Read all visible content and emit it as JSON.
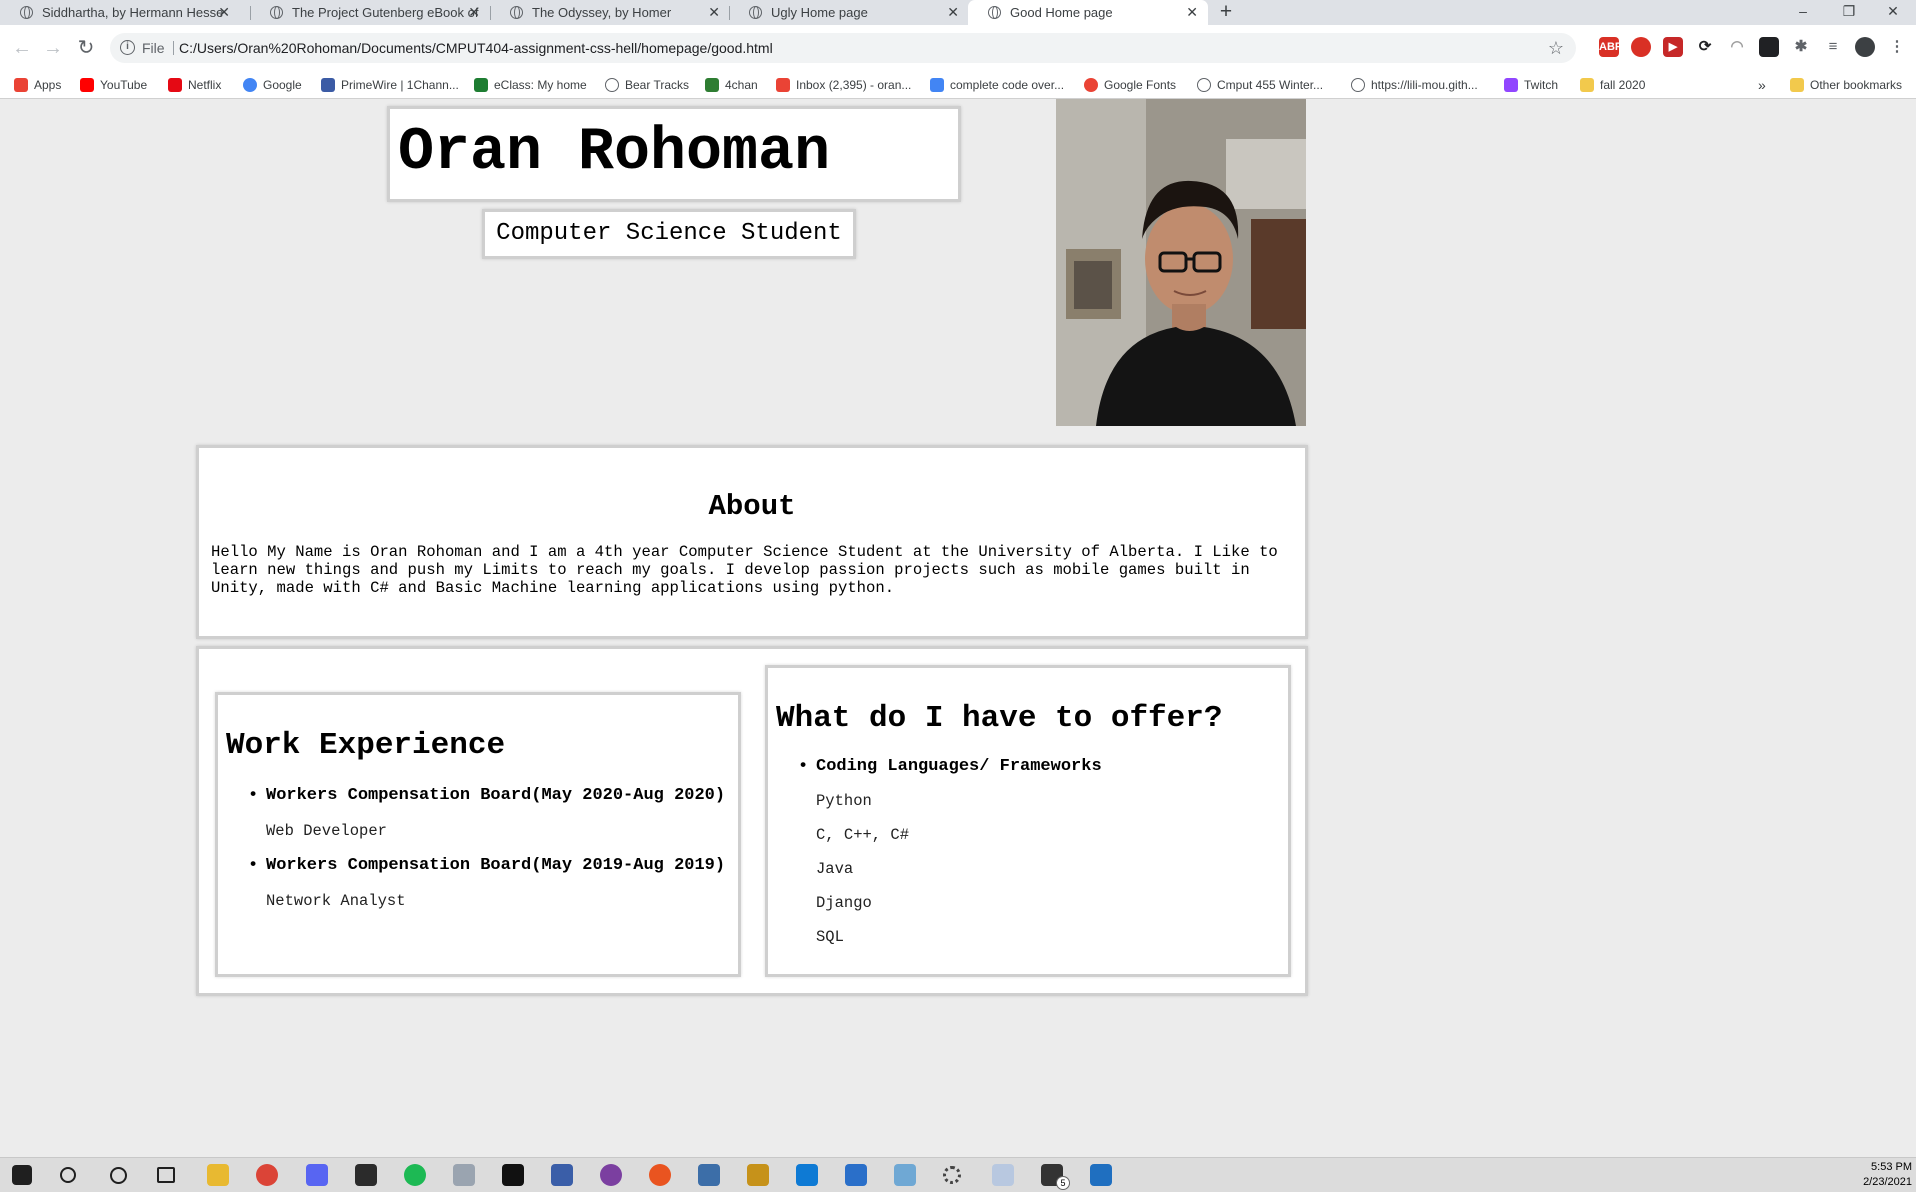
{
  "browser": {
    "tabs": [
      {
        "title": "Siddhartha, by Hermann Hesse"
      },
      {
        "title": "The Project Gutenberg eBook of"
      },
      {
        "title": "The Odyssey, by Homer"
      },
      {
        "title": "Ugly Home page"
      },
      {
        "title": "Good Home page"
      }
    ],
    "active_tab_index": 4,
    "new_tab_glyph": "+",
    "window_controls": {
      "minimize": "–",
      "restore": "❐",
      "close": "✕"
    },
    "address": {
      "scheme_label": "File",
      "url": "C:/Users/Oran%20Rohoman/Documents/CMPUT404-assignment-css-hell/homepage/good.html"
    },
    "bookmarks": [
      {
        "label": "Apps",
        "icon": "apps-grid-icon",
        "color": "#ea4335"
      },
      {
        "label": "YouTube",
        "icon": "youtube-icon",
        "color": "#ff0000"
      },
      {
        "label": "Netflix",
        "icon": "netflix-icon",
        "color": "#e50914"
      },
      {
        "label": "Google",
        "icon": "google-icon",
        "color": "#4285f4"
      },
      {
        "label": "PrimeWire | 1Chann...",
        "icon": "primewire-icon",
        "color": "#3b5ba5"
      },
      {
        "label": "eClass: My home",
        "icon": "eclass-icon",
        "color": "#1e7d32"
      },
      {
        "label": "Bear Tracks",
        "icon": "globe-icon",
        "color": "#5f6368"
      },
      {
        "label": "4chan",
        "icon": "clover-icon",
        "color": "#2e7d32"
      },
      {
        "label": "Inbox (2,395) - oran...",
        "icon": "gmail-icon",
        "color": "#ea4335"
      },
      {
        "label": "complete code over...",
        "icon": "docs-icon",
        "color": "#4285f4"
      },
      {
        "label": "Google Fonts",
        "icon": "google-fonts-icon",
        "color": "#ea4335"
      },
      {
        "label": "Cmput 455 Winter...",
        "icon": "globe-icon",
        "color": "#5f6368"
      },
      {
        "label": "https://lili-mou.gith...",
        "icon": "globe-icon",
        "color": "#5f6368"
      },
      {
        "label": "Twitch",
        "icon": "twitch-icon",
        "color": "#9146ff"
      },
      {
        "label": "fall 2020",
        "icon": "folder-icon",
        "color": "#f2c94c"
      }
    ],
    "bookmarks_overflow": "»",
    "other_bookmarks": "Other bookmarks"
  },
  "page": {
    "name": "Oran Rohoman",
    "role": "Computer Science Student",
    "photo_alt": "profile-photo",
    "about": {
      "title": "About",
      "text": "Hello My Name is Oran Rohoman and I am a 4th year Computer Science Student at the University of Alberta. I Like to learn new things and push my Limits to reach my goals. I develop passion projects such as mobile games built in Unity, made with C# and Basic Machine learning applications using python."
    },
    "work": {
      "title": "Work Experience",
      "items": [
        {
          "heading": "Workers Compensation Board(May 2020-Aug 2020)",
          "detail": "Web Developer"
        },
        {
          "heading": "Workers Compensation Board(May 2019-Aug 2019)",
          "detail": "Network Analyst"
        }
      ]
    },
    "offer": {
      "title": "What do I have to offer?",
      "heading": "Coding Languages/ Frameworks",
      "items": [
        "Python",
        "C, C++, C#",
        "Java",
        "Django",
        "SQL"
      ]
    }
  },
  "taskbar": {
    "time": "5:53 PM",
    "date": "2/23/2021",
    "badge": "5"
  },
  "colors": {
    "page_background": "#ececec",
    "box_border": "#cfcfcf",
    "tabstrip": "#dee1e6"
  }
}
